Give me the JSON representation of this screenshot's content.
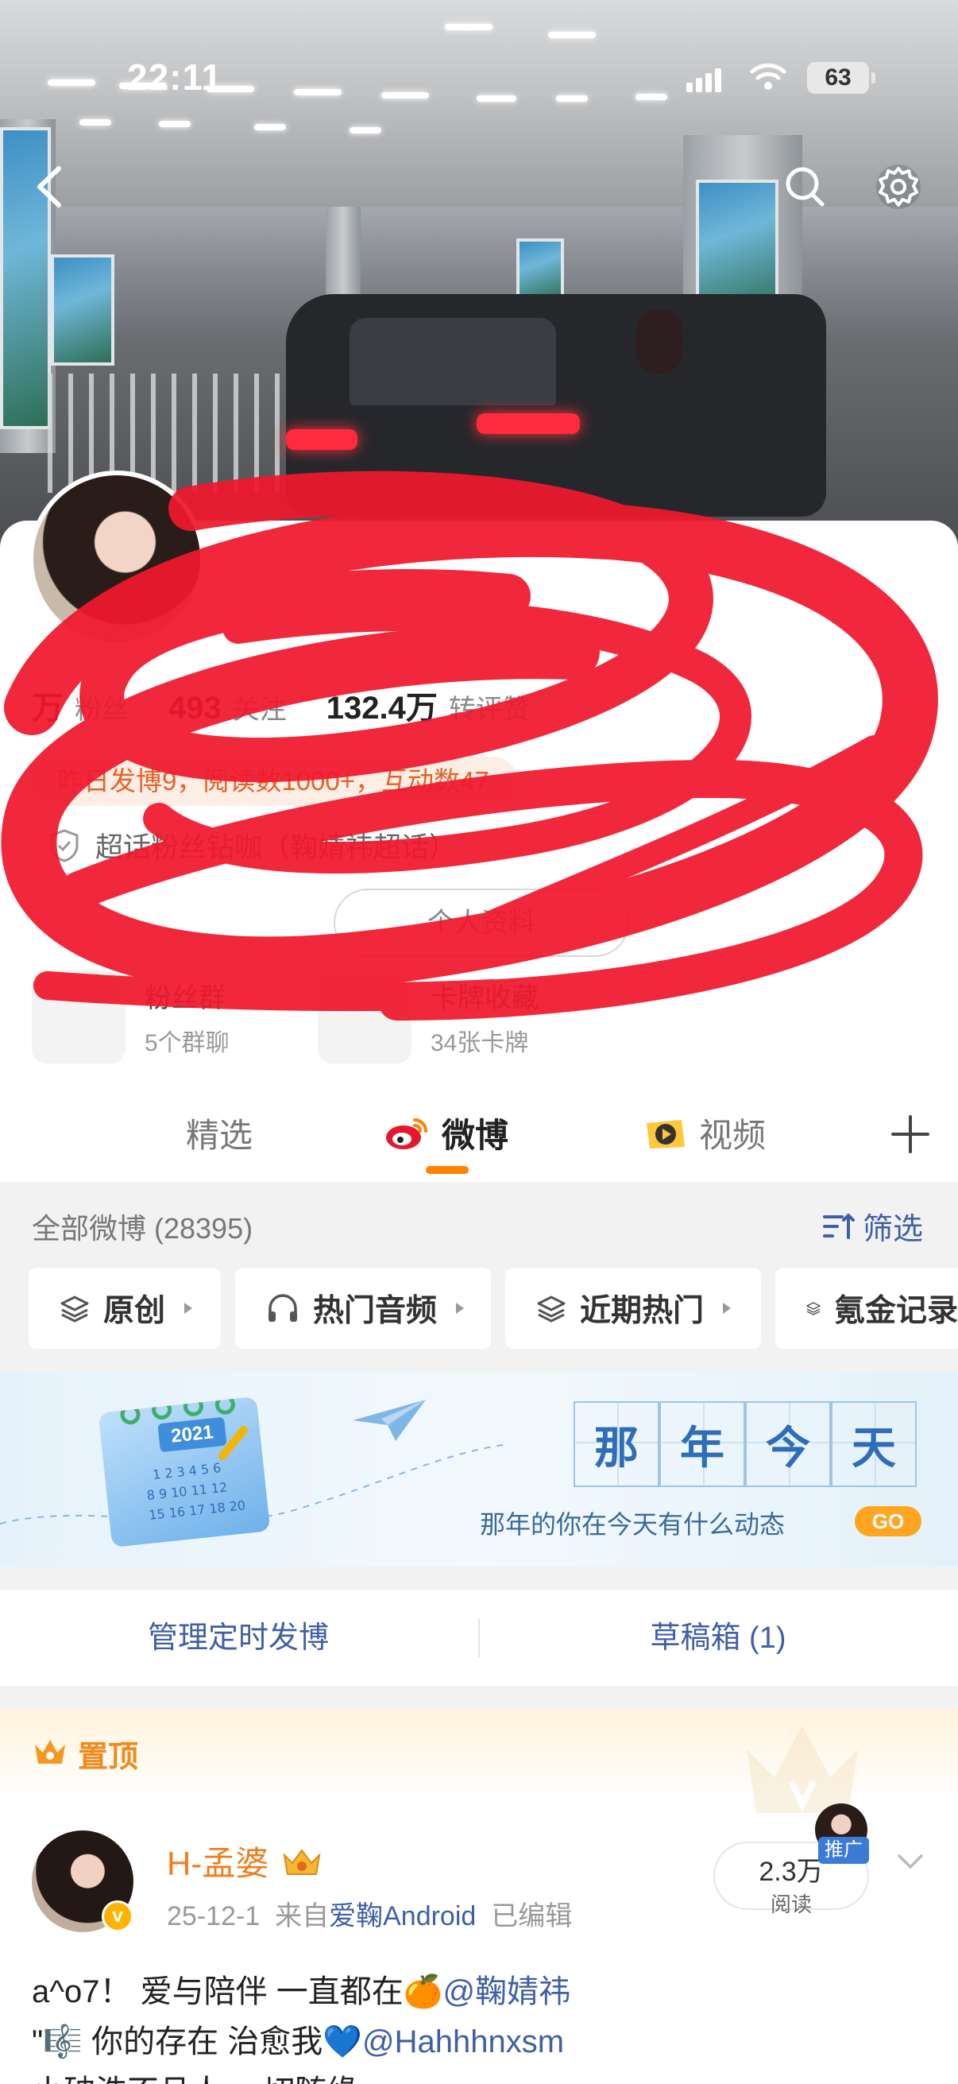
{
  "status_bar": {
    "time": "22:11",
    "battery": "63"
  },
  "profile": {
    "stats": [
      {
        "value": "万",
        "label": "粉丝"
      },
      {
        "value": "493",
        "label": "关注"
      },
      {
        "value": "132.4万",
        "label": "转评赞"
      }
    ],
    "activity": "昨日发博9，阅读数1000+，互动数47",
    "badge": "超话粉丝钻咖（鞠婧祎超话）",
    "profile_button": "个人资料",
    "entries": [
      {
        "title": "粉丝群",
        "sub": "5个群聊"
      },
      {
        "title": "卡牌收藏",
        "sub": "34张卡牌"
      }
    ]
  },
  "tabs": [
    {
      "label": "精选"
    },
    {
      "label": "微博"
    },
    {
      "label": "视频"
    }
  ],
  "feed": {
    "all_count": "全部微博 (28395)",
    "filter_label": "筛选",
    "chips": [
      "原创",
      "热门音频",
      "近期热门",
      "氪金记录"
    ]
  },
  "banner": {
    "year": "2021",
    "title_chars": [
      "那",
      "年",
      "今",
      "天"
    ],
    "subtitle": "那年的你在今天有什么动态",
    "go": "GO"
  },
  "manage": {
    "scheduled": "管理定时发博",
    "drafts": "草稿箱 (1)"
  },
  "post": {
    "pinned_label": "置顶",
    "author": "H-孟婆",
    "date": "25-12-1",
    "via_prefix": "来自",
    "source": "爱鞠Android",
    "edited": "已编辑",
    "reads_value": "2.3万",
    "reads_label": "阅读",
    "promo_tag": "推广",
    "line1_text": "a^o7！ 爱与陪伴 一直都在🍊",
    "line1_mention": "@鞠婧祎",
    "line2_text": "\"🎼 你的存在 治愈我💙",
    "line2_mention": "@Hahhhnxsm",
    "line3_text": "小破浩不且人 一切随缘"
  },
  "colors": {
    "accent_orange": "#ff8200",
    "link_blue": "#3f5fa6",
    "activity_text": "#e4622a",
    "scribble_red": "#f0182e"
  }
}
